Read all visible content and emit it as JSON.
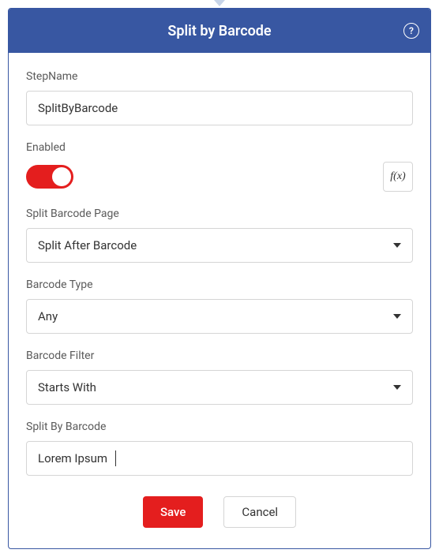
{
  "header": {
    "title": "Split by Barcode",
    "help_glyph": "?"
  },
  "fields": {
    "stepname": {
      "label": "StepName",
      "value": "SplitByBarcode"
    },
    "enabled": {
      "label": "Enabled",
      "value": true,
      "fx_label": "f(x)"
    },
    "split_barcode_page": {
      "label": "Split Barcode Page",
      "value": "Split After Barcode"
    },
    "barcode_type": {
      "label": "Barcode Type",
      "value": "Any"
    },
    "barcode_filter": {
      "label": "Barcode Filter",
      "value": "Starts With"
    },
    "split_by_barcode": {
      "label": "Split By Barcode",
      "value": "Lorem Ipsum"
    }
  },
  "footer": {
    "save_label": "Save",
    "cancel_label": "Cancel"
  }
}
